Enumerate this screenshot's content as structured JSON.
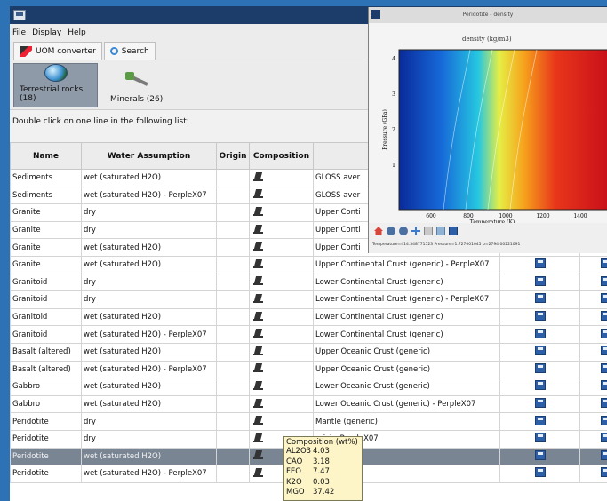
{
  "menu": [
    "File",
    "Display",
    "Help"
  ],
  "tool_tabs": [
    {
      "label": "UOM converter",
      "icon": "uom-converter-icon"
    },
    {
      "label": "Search",
      "icon": "search-icon"
    }
  ],
  "categories": [
    {
      "label": "Terrestrial rocks (18)",
      "icon": "globe-icon",
      "selected": true
    },
    {
      "label": "Minerals (26)",
      "icon": "hammer-icon",
      "selected": false
    }
  ],
  "instruction": "Double click on one line in the following list:",
  "table": {
    "headers": [
      "Name",
      "Water Assumption",
      "Origin",
      "Composition",
      "",
      "",
      ""
    ],
    "rows": [
      {
        "name": "Sediments",
        "water": "wet (saturated H2O)",
        "origin": "",
        "desc": "GLOSS aver",
        "selected": false
      },
      {
        "name": "Sediments",
        "water": "wet (saturated H2O) - PerpleX07",
        "origin": "",
        "desc": "GLOSS aver",
        "selected": false
      },
      {
        "name": "Granite",
        "water": "dry",
        "origin": "",
        "desc": "Upper Conti",
        "selected": false
      },
      {
        "name": "Granite",
        "water": "dry",
        "origin": "",
        "desc": "Upper Conti",
        "selected": false
      },
      {
        "name": "Granite",
        "water": "wet (saturated H2O)",
        "origin": "",
        "desc": "Upper Conti",
        "selected": false
      },
      {
        "name": "Granite",
        "water": "wet (saturated H2O)",
        "origin": "",
        "desc": "Upper Continental Crust (generic) - PerpleX07",
        "selected": false
      },
      {
        "name": "Granitoid",
        "water": "dry",
        "origin": "",
        "desc": "Lower Continental Crust (generic)",
        "selected": false
      },
      {
        "name": "Granitoid",
        "water": "dry",
        "origin": "",
        "desc": "Lower Continental Crust (generic) - PerpleX07",
        "selected": false
      },
      {
        "name": "Granitoid",
        "water": "wet (saturated H2O)",
        "origin": "",
        "desc": "Lower Continental Crust (generic)",
        "selected": false
      },
      {
        "name": "Granitoid",
        "water": "wet (saturated H2O) - PerpleX07",
        "origin": "",
        "desc": "Lower Continental Crust (generic)",
        "selected": false
      },
      {
        "name": "Basalt (altered)",
        "water": "wet (saturated H2O)",
        "origin": "",
        "desc": "Upper Oceanic Crust (generic)",
        "selected": false
      },
      {
        "name": "Basalt (altered)",
        "water": "wet (saturated H2O) - PerpleX07",
        "origin": "",
        "desc": "Upper Oceanic Crust (generic)",
        "selected": false
      },
      {
        "name": "Gabbro",
        "water": "wet (saturated H2O)",
        "origin": "",
        "desc": "Lower Oceanic Crust (generic)",
        "selected": false
      },
      {
        "name": "Gabbro",
        "water": "wet (saturated H2O)",
        "origin": "",
        "desc": "Lower Oceanic Crust (generic) - PerpleX07",
        "selected": false
      },
      {
        "name": "Peridotite",
        "water": "dry",
        "origin": "",
        "desc": "Mantle (generic)",
        "selected": false
      },
      {
        "name": "Peridotite",
        "water": "dry",
        "origin": "",
        "desc": "eric) - PerpleX07",
        "selected": false
      },
      {
        "name": "Peridotite",
        "water": "wet (saturated H2O)",
        "origin": "",
        "desc": "eric)",
        "selected": true
      },
      {
        "name": "Peridotite",
        "water": "wet (saturated H2O) - PerpleX07",
        "origin": "",
        "desc": "eric)",
        "selected": false
      }
    ]
  },
  "tooltip": {
    "title": "Composition (wt%)",
    "rows": [
      {
        "k": "AL2O3",
        "v": "4.03"
      },
      {
        "k": "CAO",
        "v": "3.18"
      },
      {
        "k": "FEO",
        "v": "7.47"
      },
      {
        "k": "K2O",
        "v": "0.03"
      },
      {
        "k": "MGO",
        "v": "37.42"
      }
    ]
  },
  "plot_window": {
    "title": "Peridotite - density",
    "chart_heading": "density (kg/m3)",
    "coords": "Temperature=414.348771523  Pressure=1.727001045  ρ=2794.00221091"
  },
  "chart_data": {
    "type": "heatmap",
    "title": "density (kg/m3)",
    "xlabel": "Temperature (K)",
    "ylabel": "Pressure (GPa)",
    "x_ticks": [
      "600",
      "800",
      "1000",
      "1200",
      "1400"
    ],
    "y_ticks": [
      "1",
      "2",
      "3",
      "4"
    ],
    "colormap": "jet"
  },
  "colors": {
    "window_title": "#1c3d6a",
    "selected_row": "#7a8594",
    "tooltip_bg": "#fdf5c8",
    "desktop": "#2e72b6"
  }
}
